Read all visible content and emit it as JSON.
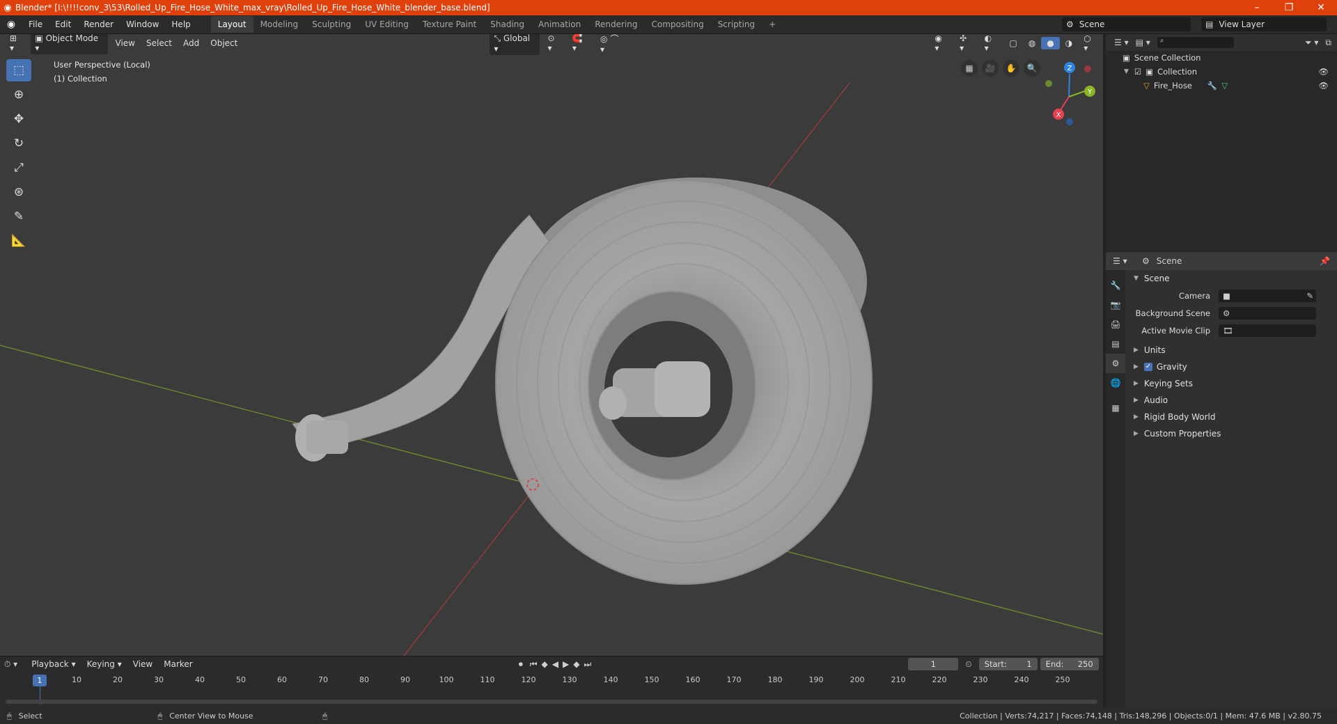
{
  "window": {
    "title": "Blender* [I:\\!!!!conv_3\\53\\Rolled_Up_Fire_Hose_White_max_vray\\Rolled_Up_Fire_Hose_White_blender_base.blend]",
    "minimize": "–",
    "maximize": "❐",
    "close": "✕"
  },
  "menu": [
    "File",
    "Edit",
    "Render",
    "Window",
    "Help"
  ],
  "workspaces": [
    "Layout",
    "Modeling",
    "Sculpting",
    "UV Editing",
    "Texture Paint",
    "Shading",
    "Animation",
    "Rendering",
    "Compositing",
    "Scripting"
  ],
  "workspace_add": "+",
  "scene_selector": "Scene",
  "view_layer": "View Layer",
  "viewport": {
    "mode": "Object Mode",
    "menus": [
      "View",
      "Select",
      "Add",
      "Object"
    ],
    "orientation": "Global",
    "info_line1": "User Perspective (Local)",
    "info_line2": "(1) Collection",
    "gizmo": {
      "x": "X",
      "y": "Y",
      "z": "Z"
    }
  },
  "outliner": {
    "root": "Scene Collection",
    "collection": "Collection",
    "object": "Fire_Hose"
  },
  "properties": {
    "header": "Scene",
    "section": "Scene",
    "fields": [
      {
        "label": "Camera",
        "value": ""
      },
      {
        "label": "Background Scene",
        "value": ""
      },
      {
        "label": "Active Movie Clip",
        "value": ""
      }
    ],
    "panels": [
      "Units",
      "Gravity",
      "Keying Sets",
      "Audio",
      "Rigid Body World",
      "Custom Properties"
    ],
    "gravity_checked": true
  },
  "timeline": {
    "menus": [
      "Playback",
      "Keying",
      "View",
      "Marker"
    ],
    "current_frame": "1",
    "start_label": "Start:",
    "start": "1",
    "end_label": "End:",
    "end": "250",
    "ticks": [
      "10",
      "20",
      "30",
      "40",
      "50",
      "60",
      "70",
      "80",
      "90",
      "100",
      "110",
      "120",
      "130",
      "140",
      "150",
      "160",
      "170",
      "180",
      "190",
      "200",
      "210",
      "220",
      "230",
      "240",
      "250"
    ],
    "frame_marker": "1"
  },
  "status": {
    "left": "Select",
    "middle": "Center View to Mouse",
    "right": "Collection | Verts:74,217 | Faces:74,148 | Tris:148,296 | Objects:0/1 | Mem: 47.6 MB | v2.80.75"
  },
  "colors": {
    "titlebar": "#e0400c",
    "accent": "#4772b3",
    "axis_x": "#e8404d",
    "axis_y": "#8bb526",
    "axis_z": "#2f83e0"
  }
}
